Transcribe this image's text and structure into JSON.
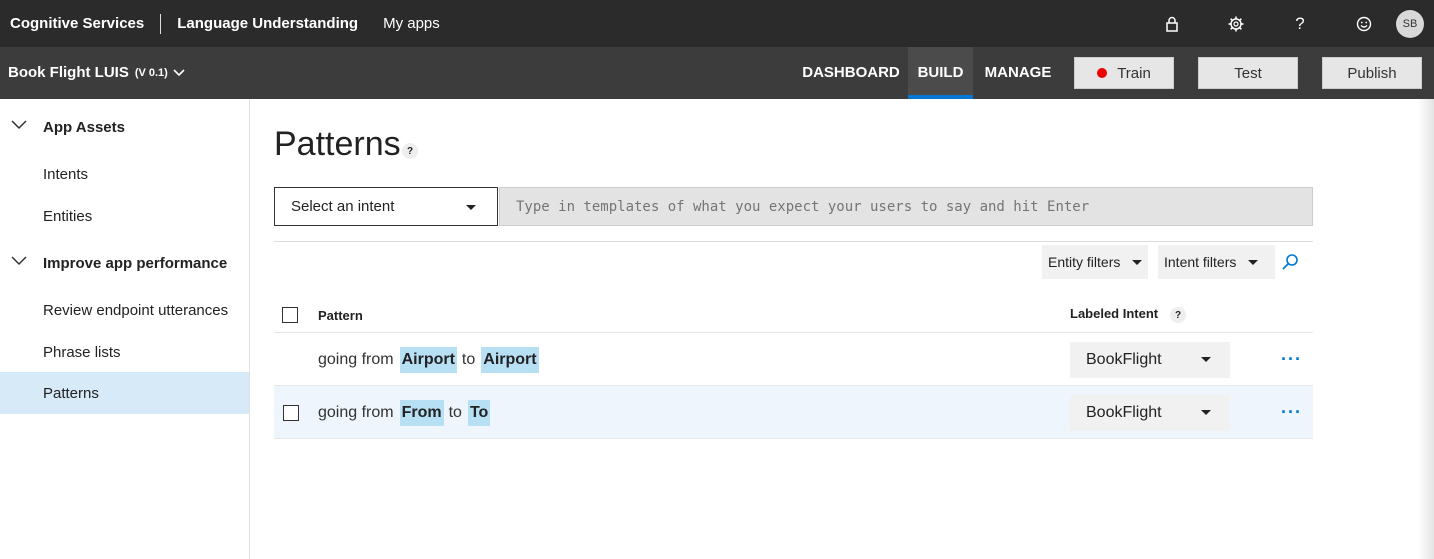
{
  "topbar": {
    "brand": "Cognitive Services",
    "product": "Language Understanding",
    "my_apps": "My apps",
    "avatar_initials": "SB",
    "icons": [
      "lock-icon",
      "gear-icon",
      "help-icon",
      "smiley-icon"
    ]
  },
  "appbar": {
    "app_name": "Book Flight LUIS",
    "version": "(V 0.1)",
    "tabs": [
      {
        "label": "DASHBOARD",
        "active": false
      },
      {
        "label": "BUILD",
        "active": true
      },
      {
        "label": "MANAGE",
        "active": false
      }
    ],
    "train_label": "Train",
    "test_label": "Test",
    "publish_label": "Publish"
  },
  "sidebar": {
    "groups": [
      {
        "label": "App Assets",
        "items": [
          "Intents",
          "Entities"
        ]
      },
      {
        "label": "Improve app performance",
        "items": [
          "Review endpoint utterances",
          "Phrase lists",
          "Patterns"
        ]
      }
    ],
    "active_item": "Patterns"
  },
  "main": {
    "title": "Patterns",
    "help_glyph": "?",
    "select_intent_label": "Select an intent",
    "pattern_input_placeholder": "Type in templates of what you expect your users to say and hit Enter",
    "entity_filters_label": "Entity filters",
    "intent_filters_label": "Intent filters",
    "columns": {
      "pattern": "Pattern",
      "labeled_intent": "Labeled Intent"
    },
    "rows": [
      {
        "going": "going from",
        "entity1": "Airport",
        "to": "to",
        "entity2": "Airport",
        "intent": "BookFlight",
        "has_checkbox": false
      },
      {
        "going": "going from",
        "entity1": "From",
        "to": "to",
        "entity2": "To",
        "intent": "BookFlight",
        "has_checkbox": true
      }
    ],
    "more_glyph": "···"
  },
  "colors": {
    "accent": "#0078d4",
    "entity_highlight": "#b8e0f5",
    "train_dot": "#e00000"
  }
}
